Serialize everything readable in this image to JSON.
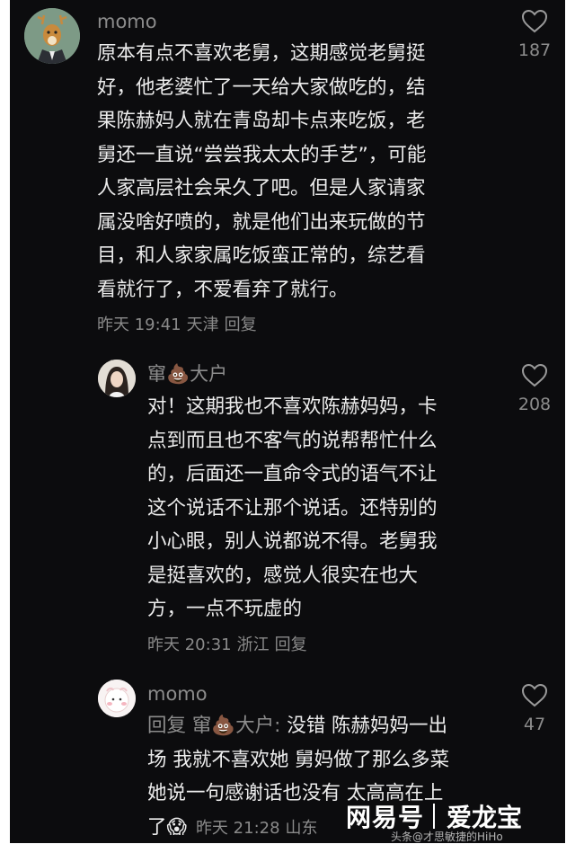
{
  "comments": [
    {
      "username": "momo",
      "text": "原本有点不喜欢老舅，这期感觉老舅挺\n好，他老婆忙了一天给大家做吃的，结\n果陈赫妈人就在青岛却卡点来吃饭，老\n舅还一直说“尝尝我太太的手艺”，可能\n人家高层社会呆久了吧。但是人家请家\n属没啥好喷的，就是他们出来玩做的节\n目，和人家家属吃饭蛮正常的，综艺看\n看就行了，不爱看弃了就行。",
      "time": "昨天 19:41",
      "location": "天津",
      "reply_label": "回复",
      "likes": "187",
      "avatar_icon": "deer-icon"
    },
    {
      "username": "窜💩大户",
      "text": "对！这期我也不喜欢陈赫妈妈，卡\n点到而且也不客气的说帮帮忙什么\n的，后面还一直命令式的语气不让\n这个说话不让那个说话。还特别的\n小心眼，别人说都说不得。老舅我\n是挺喜欢的，感觉人很实在也大\n方，一点不玩虚的",
      "time": "昨天 20:31",
      "location": "浙江",
      "reply_label": "回复",
      "likes": "208",
      "avatar_icon": "girl-avatar-icon"
    },
    {
      "username": "momo",
      "reply_prefix": "回复",
      "reply_to": "窜💩大户:",
      "text": "没错 陈赫妈妈一出\n场 我就不喜欢她 舅妈做了那么多菜\n她说一句感谢话也没有 太高高在上\n了",
      "emoji": "😱",
      "time": "昨天 21:28",
      "location": "山东",
      "likes": "47",
      "avatar_icon": "cartoon-face-icon"
    }
  ],
  "watermark": {
    "brand": "网易号",
    "name": "爱龙宝",
    "sub": "头条@才思敏捷的HiHo"
  },
  "colors": {
    "background": "#0c0c0e",
    "text": "#ececec",
    "secondary": "#8c8c8c"
  }
}
